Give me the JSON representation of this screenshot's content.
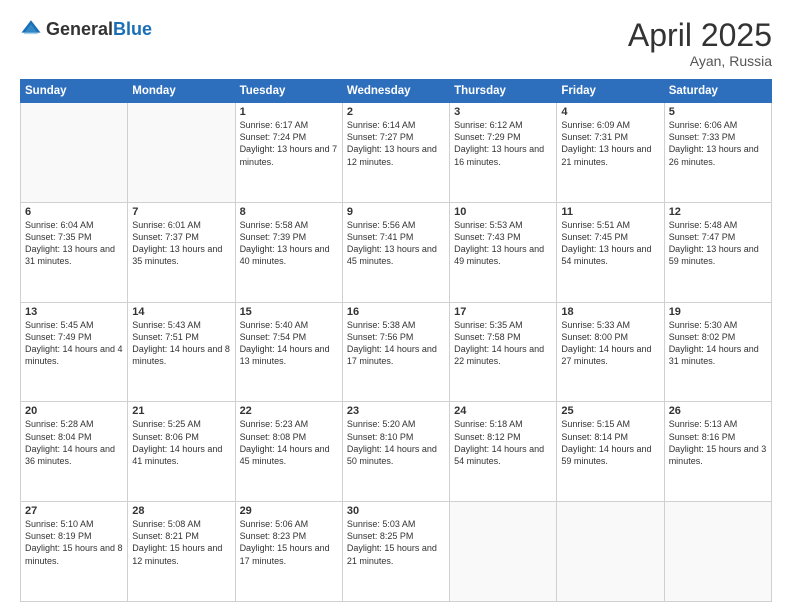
{
  "header": {
    "logo_general": "General",
    "logo_blue": "Blue",
    "month_year": "April 2025",
    "location": "Ayan, Russia"
  },
  "weekdays": [
    "Sunday",
    "Monday",
    "Tuesday",
    "Wednesday",
    "Thursday",
    "Friday",
    "Saturday"
  ],
  "weeks": [
    [
      null,
      null,
      {
        "day": "1",
        "sunrise": "6:17 AM",
        "sunset": "7:24 PM",
        "daylight": "13 hours and 7 minutes."
      },
      {
        "day": "2",
        "sunrise": "6:14 AM",
        "sunset": "7:27 PM",
        "daylight": "13 hours and 12 minutes."
      },
      {
        "day": "3",
        "sunrise": "6:12 AM",
        "sunset": "7:29 PM",
        "daylight": "13 hours and 16 minutes."
      },
      {
        "day": "4",
        "sunrise": "6:09 AM",
        "sunset": "7:31 PM",
        "daylight": "13 hours and 21 minutes."
      },
      {
        "day": "5",
        "sunrise": "6:06 AM",
        "sunset": "7:33 PM",
        "daylight": "13 hours and 26 minutes."
      }
    ],
    [
      {
        "day": "6",
        "sunrise": "6:04 AM",
        "sunset": "7:35 PM",
        "daylight": "13 hours and 31 minutes."
      },
      {
        "day": "7",
        "sunrise": "6:01 AM",
        "sunset": "7:37 PM",
        "daylight": "13 hours and 35 minutes."
      },
      {
        "day": "8",
        "sunrise": "5:58 AM",
        "sunset": "7:39 PM",
        "daylight": "13 hours and 40 minutes."
      },
      {
        "day": "9",
        "sunrise": "5:56 AM",
        "sunset": "7:41 PM",
        "daylight": "13 hours and 45 minutes."
      },
      {
        "day": "10",
        "sunrise": "5:53 AM",
        "sunset": "7:43 PM",
        "daylight": "13 hours and 49 minutes."
      },
      {
        "day": "11",
        "sunrise": "5:51 AM",
        "sunset": "7:45 PM",
        "daylight": "13 hours and 54 minutes."
      },
      {
        "day": "12",
        "sunrise": "5:48 AM",
        "sunset": "7:47 PM",
        "daylight": "13 hours and 59 minutes."
      }
    ],
    [
      {
        "day": "13",
        "sunrise": "5:45 AM",
        "sunset": "7:49 PM",
        "daylight": "14 hours and 4 minutes."
      },
      {
        "day": "14",
        "sunrise": "5:43 AM",
        "sunset": "7:51 PM",
        "daylight": "14 hours and 8 minutes."
      },
      {
        "day": "15",
        "sunrise": "5:40 AM",
        "sunset": "7:54 PM",
        "daylight": "14 hours and 13 minutes."
      },
      {
        "day": "16",
        "sunrise": "5:38 AM",
        "sunset": "7:56 PM",
        "daylight": "14 hours and 17 minutes."
      },
      {
        "day": "17",
        "sunrise": "5:35 AM",
        "sunset": "7:58 PM",
        "daylight": "14 hours and 22 minutes."
      },
      {
        "day": "18",
        "sunrise": "5:33 AM",
        "sunset": "8:00 PM",
        "daylight": "14 hours and 27 minutes."
      },
      {
        "day": "19",
        "sunrise": "5:30 AM",
        "sunset": "8:02 PM",
        "daylight": "14 hours and 31 minutes."
      }
    ],
    [
      {
        "day": "20",
        "sunrise": "5:28 AM",
        "sunset": "8:04 PM",
        "daylight": "14 hours and 36 minutes."
      },
      {
        "day": "21",
        "sunrise": "5:25 AM",
        "sunset": "8:06 PM",
        "daylight": "14 hours and 41 minutes."
      },
      {
        "day": "22",
        "sunrise": "5:23 AM",
        "sunset": "8:08 PM",
        "daylight": "14 hours and 45 minutes."
      },
      {
        "day": "23",
        "sunrise": "5:20 AM",
        "sunset": "8:10 PM",
        "daylight": "14 hours and 50 minutes."
      },
      {
        "day": "24",
        "sunrise": "5:18 AM",
        "sunset": "8:12 PM",
        "daylight": "14 hours and 54 minutes."
      },
      {
        "day": "25",
        "sunrise": "5:15 AM",
        "sunset": "8:14 PM",
        "daylight": "14 hours and 59 minutes."
      },
      {
        "day": "26",
        "sunrise": "5:13 AM",
        "sunset": "8:16 PM",
        "daylight": "15 hours and 3 minutes."
      }
    ],
    [
      {
        "day": "27",
        "sunrise": "5:10 AM",
        "sunset": "8:19 PM",
        "daylight": "15 hours and 8 minutes."
      },
      {
        "day": "28",
        "sunrise": "5:08 AM",
        "sunset": "8:21 PM",
        "daylight": "15 hours and 12 minutes."
      },
      {
        "day": "29",
        "sunrise": "5:06 AM",
        "sunset": "8:23 PM",
        "daylight": "15 hours and 17 minutes."
      },
      {
        "day": "30",
        "sunrise": "5:03 AM",
        "sunset": "8:25 PM",
        "daylight": "15 hours and 21 minutes."
      },
      null,
      null,
      null
    ]
  ]
}
